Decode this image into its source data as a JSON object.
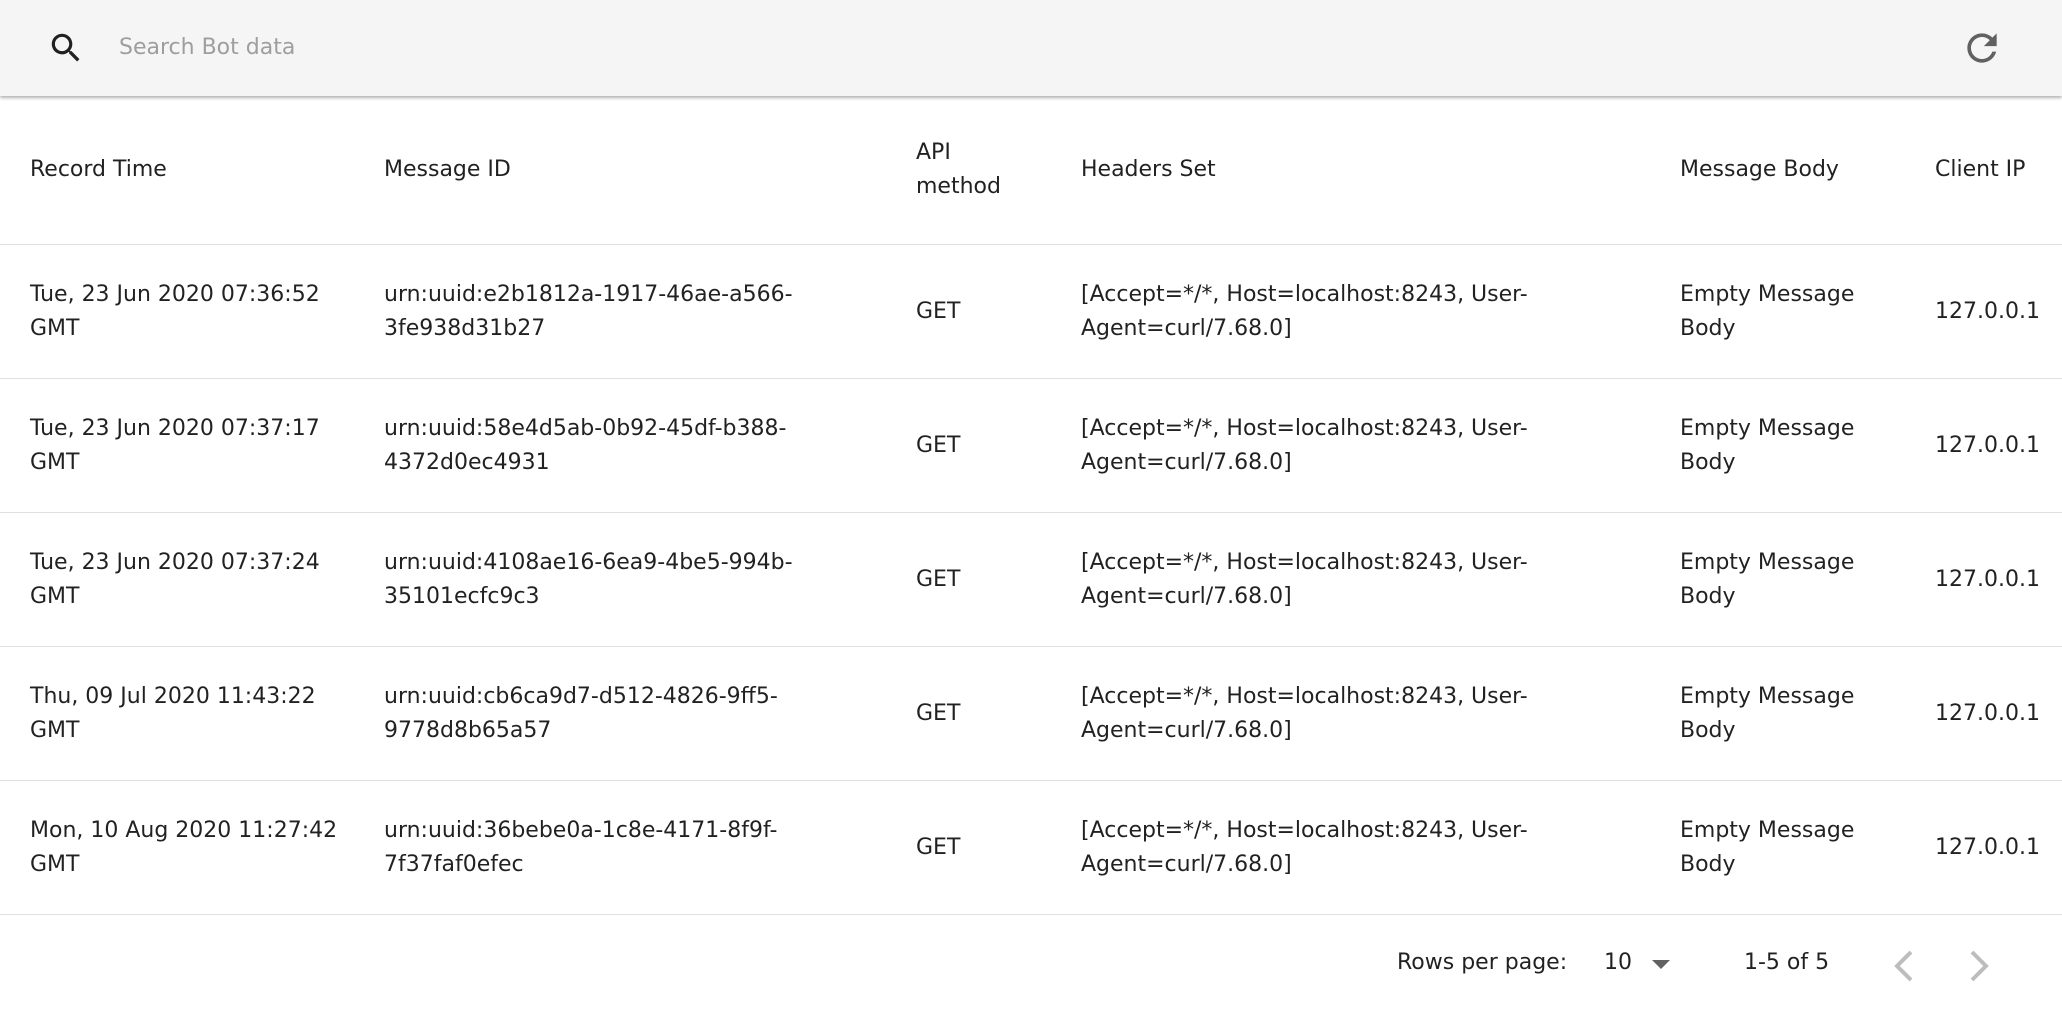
{
  "search": {
    "placeholder": "Search Bot data",
    "value": "",
    "icon": "search-icon"
  },
  "toolbar": {
    "refresh_icon": "refresh-icon"
  },
  "table": {
    "columns": [
      "Record Time",
      "Message ID",
      "API method",
      "Headers Set",
      "Message Body",
      "Client IP"
    ],
    "rows": [
      {
        "record_time": "Tue, 23 Jun 2020 07:36:52 GMT",
        "message_id": "urn:uuid:e2b1812a-1917-46ae-a566-3fe938d31b27",
        "api_method": "GET",
        "headers_set": "[Accept=*/*, Host=localhost:8243, User-Agent=curl/7.68.0]",
        "message_body": "Empty Message Body",
        "client_ip": "127.0.0.1"
      },
      {
        "record_time": "Tue, 23 Jun 2020 07:37:17 GMT",
        "message_id": "urn:uuid:58e4d5ab-0b92-45df-b388-4372d0ec4931",
        "api_method": "GET",
        "headers_set": "[Accept=*/*, Host=localhost:8243, User-Agent=curl/7.68.0]",
        "message_body": "Empty Message Body",
        "client_ip": "127.0.0.1"
      },
      {
        "record_time": "Tue, 23 Jun 2020 07:37:24 GMT",
        "message_id": "urn:uuid:4108ae16-6ea9-4be5-994b-35101ecfc9c3",
        "api_method": "GET",
        "headers_set": "[Accept=*/*, Host=localhost:8243, User-Agent=curl/7.68.0]",
        "message_body": "Empty Message Body",
        "client_ip": "127.0.0.1"
      },
      {
        "record_time": "Thu, 09 Jul 2020 11:43:22 GMT",
        "message_id": "urn:uuid:cb6ca9d7-d512-4826-9ff5-9778d8b65a57",
        "api_method": "GET",
        "headers_set": "[Accept=*/*, Host=localhost:8243, User-Agent=curl/7.68.0]",
        "message_body": "Empty Message Body",
        "client_ip": "127.0.0.1"
      },
      {
        "record_time": "Mon, 10 Aug 2020 11:27:42 GMT",
        "message_id": "urn:uuid:36bebe0a-1c8e-4171-8f9f-7f37faf0efec",
        "api_method": "GET",
        "headers_set": "[Accept=*/*, Host=localhost:8243, User-Agent=curl/7.68.0]",
        "message_body": "Empty Message Body",
        "client_ip": "127.0.0.1"
      }
    ]
  },
  "pagination": {
    "rows_per_page_label": "Rows per page:",
    "rows_per_page_value": "10",
    "range_text": "1-5 of 5",
    "prev_icon": "chevron-left-icon",
    "next_icon": "chevron-right-icon"
  }
}
